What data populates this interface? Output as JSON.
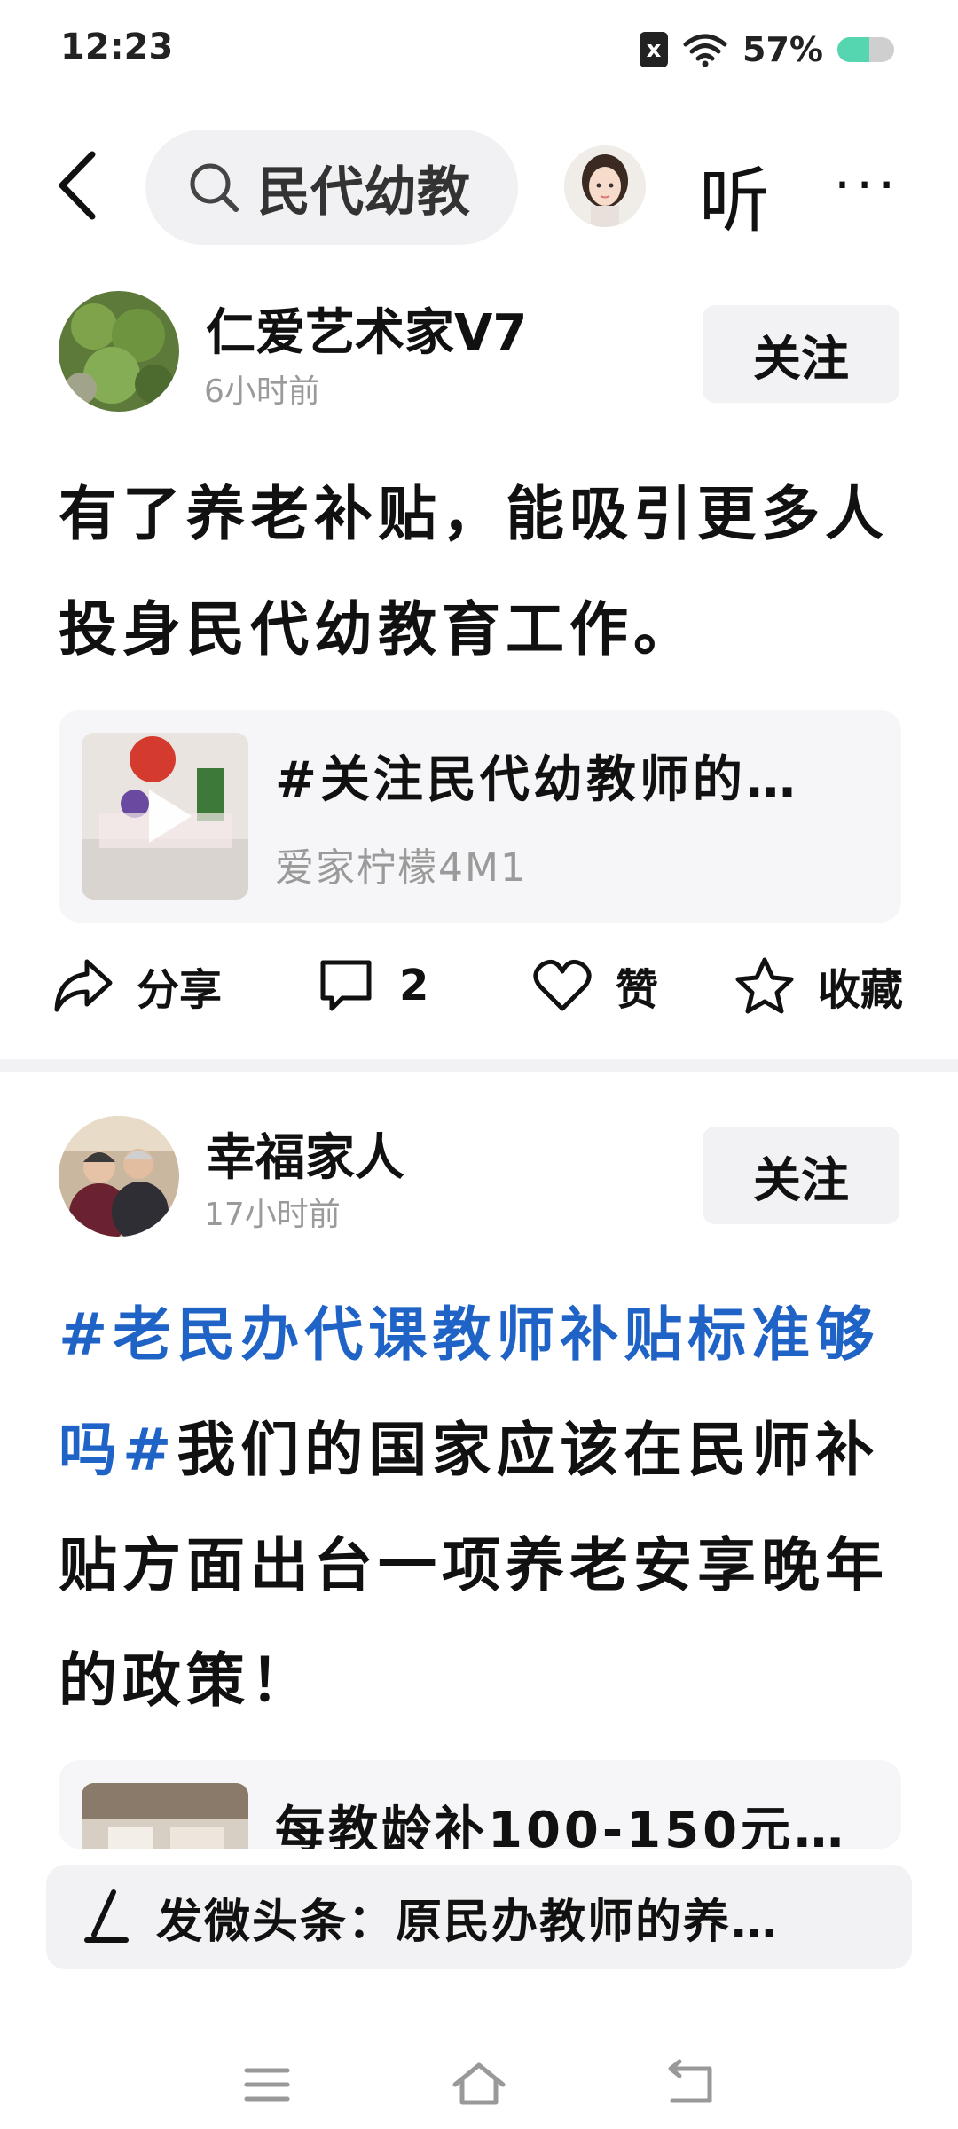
{
  "status_bar": {
    "time": "12:23",
    "battery": "57%",
    "battery_level": 0.57,
    "sim_badge": "x"
  },
  "top_nav": {
    "search_query": "民代幼教",
    "listen_label": "听",
    "more_label": "···"
  },
  "posts": [
    {
      "author": "仁爱艺术家V7",
      "time": "6小时前",
      "follow_label": "关注",
      "text": "有了养老补贴，能吸引更多人投身民代幼教育工作。",
      "card": {
        "title": "#关注民代幼教师的…",
        "subtitle": "爱家柠檬4M1"
      },
      "actions": {
        "share": "分享",
        "comments": "2",
        "like": "赞",
        "favorite": "收藏"
      }
    },
    {
      "author": "幸福家人",
      "time": "17小时前",
      "follow_label": "关注",
      "hashtag": "#老民办代课教师补贴标准够吗#",
      "text": "我们的国家应该在民师补贴方面出台一项养老安享晚年的政策！",
      "card": {
        "title": "每教龄补100-150元…"
      }
    }
  ],
  "compose": {
    "text": "发微头条：原民办教师的养…"
  },
  "colors": {
    "hashtag": "#1f63c7",
    "battery": "#55d6b0"
  },
  "icons": [
    "back-arrow-icon",
    "search-icon",
    "share-icon",
    "comment-icon",
    "heart-icon",
    "star-icon",
    "pen-icon",
    "menu-icon",
    "home-icon",
    "return-icon"
  ]
}
